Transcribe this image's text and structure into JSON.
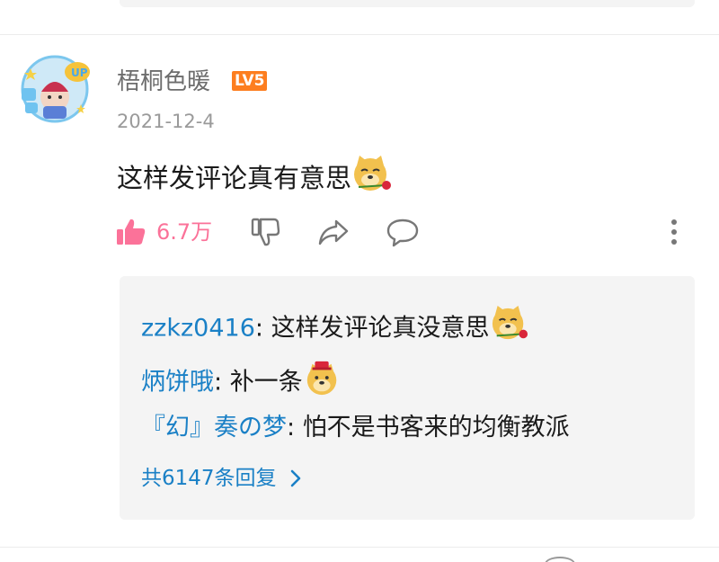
{
  "comment": {
    "username": "梧桐色暖",
    "level": "LV5",
    "date": "2021-12-4",
    "text": "这样发评论真有意思",
    "emote": "doge-rose-emote",
    "likes": "6.7万"
  },
  "icons": {
    "like": "thumbs-up-icon",
    "dislike": "thumbs-down-icon",
    "share": "share-icon",
    "reply": "reply-bubble-icon",
    "more": "more-vertical-icon"
  },
  "replies": [
    {
      "author": "zzkz0416",
      "separator": ": ",
      "text": "这样发评论真没意思",
      "emote": "doge-rose-emote"
    },
    {
      "author": "炳饼哦",
      "separator": ": ",
      "text": "补一条",
      "emote": "doge-hat-emote"
    },
    {
      "author": "『幻』奏の梦",
      "separator": ": ",
      "text": "怕不是书客来的均衡教派",
      "emote": ""
    }
  ],
  "more_replies_label": "共6147条回复",
  "colors": {
    "like_active": "#fb7299",
    "link_blue": "#1a80c6",
    "level_badge": "#fd7e1f",
    "reply_bg": "#f4f4f4"
  }
}
